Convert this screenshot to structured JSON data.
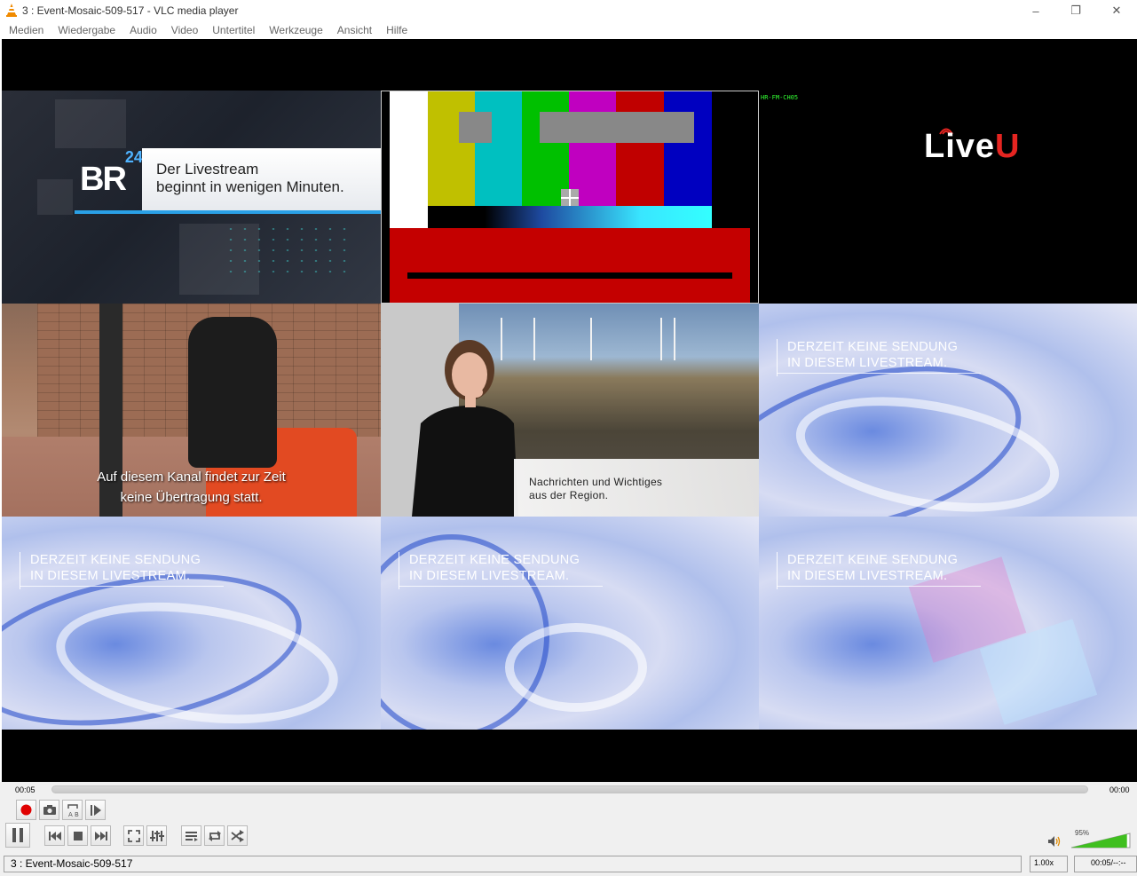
{
  "window": {
    "title": "3 : Event-Mosaic-509-517 - VLC media player",
    "minimize": "–",
    "maximize": "❐",
    "close": "✕"
  },
  "menu": [
    "Medien",
    "Wiedergabe",
    "Audio",
    "Video",
    "Untertitel",
    "Werkzeuge",
    "Ansicht",
    "Hilfe"
  ],
  "video": {
    "br24": {
      "logo": "BR",
      "logo_sup": "24",
      "line1": "Der Livestream",
      "line2": "beginnt in wenigen Minuten."
    },
    "liveu": {
      "label": "HR-FM-CH05",
      "brand_a": "Live",
      "brand_b": "U"
    },
    "forklift": {
      "line1": "Auf diesem Kanal findet zur Zeit",
      "line2": "keine Übertragung statt."
    },
    "sign": {
      "line1": "Nachrichten  und  Wichtiges",
      "line2": "aus  der  Region."
    },
    "no_broadcast": {
      "line1": "DERZEIT KEINE SENDUNG",
      "line2": "IN DIESEM LIVESTREAM."
    }
  },
  "controls": {
    "time_elapsed": "00:05",
    "time_total": "00:00",
    "volume_pct_label": "95%",
    "volume_level": 0.95
  },
  "status": {
    "media": "3 : Event-Mosaic-509-517",
    "speed": "1.00x",
    "time": "00:05/--:--"
  },
  "colors": {
    "accent_green": "#3fbf1f",
    "record_red": "#e00000",
    "liveu_red": "#e52521",
    "br_blue": "#2aa0e6"
  }
}
